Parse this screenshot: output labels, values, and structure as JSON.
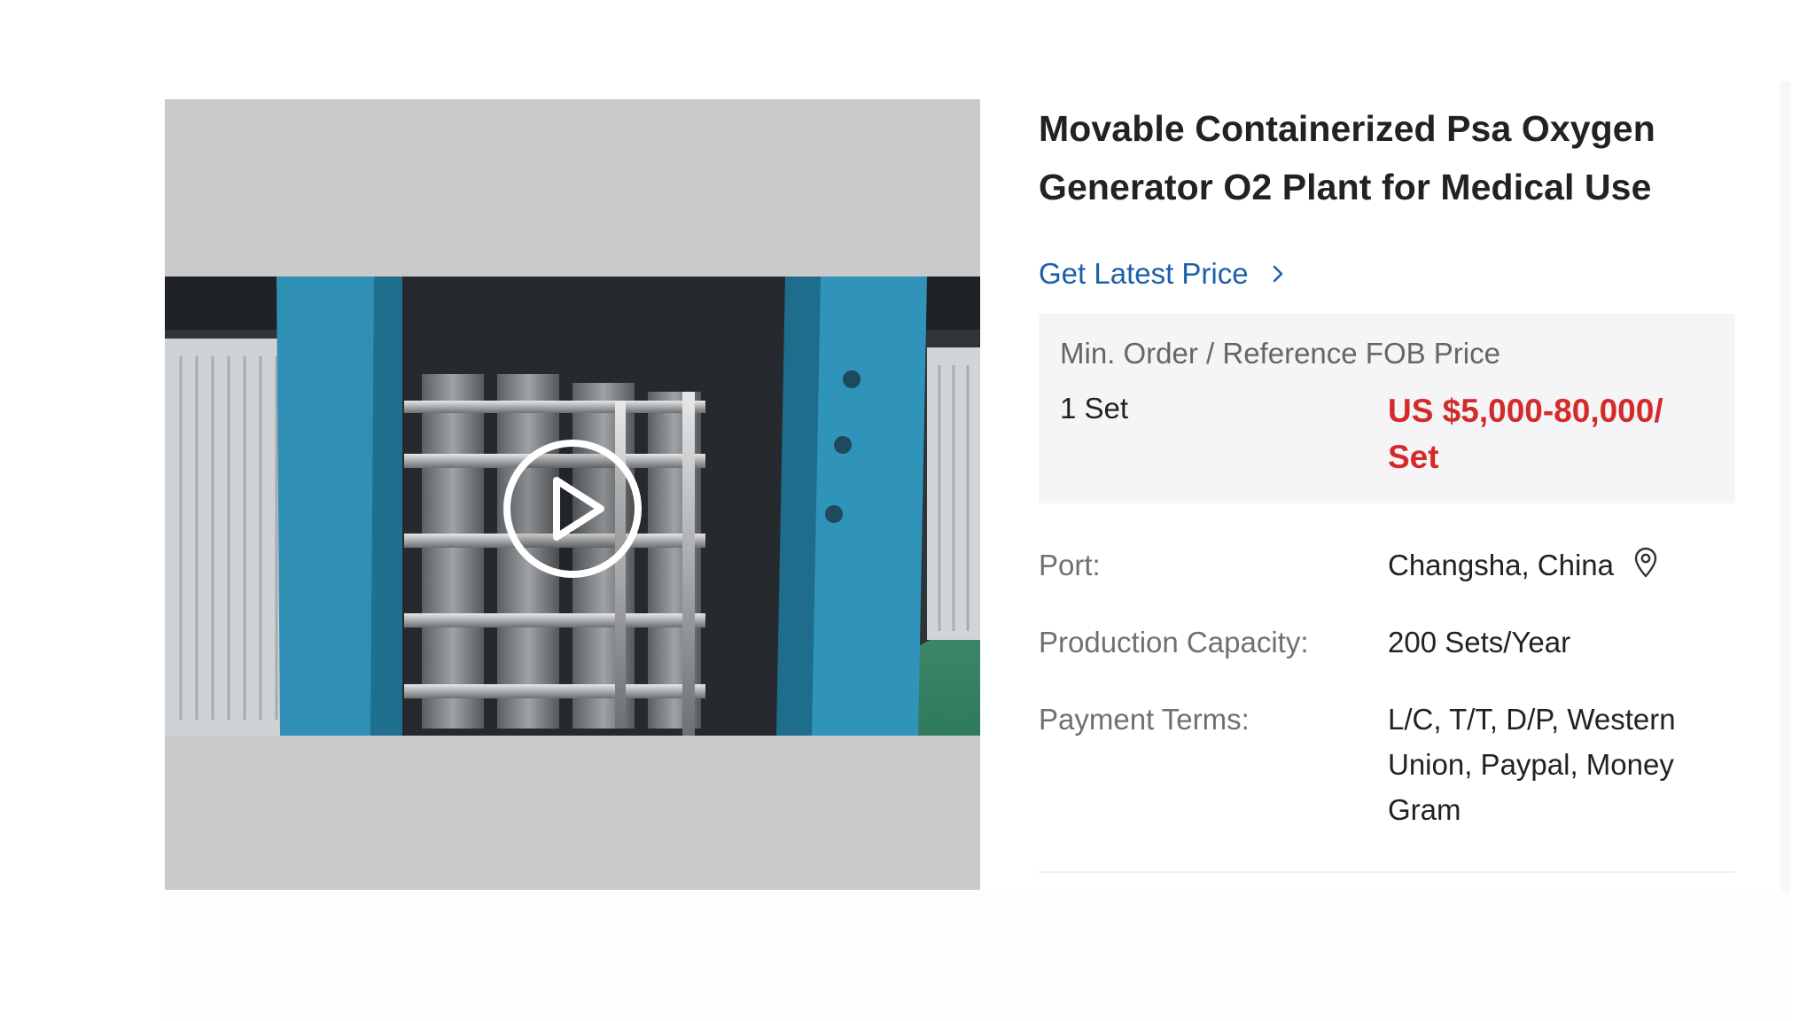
{
  "product": {
    "title": "Movable Containerized Psa Oxygen Generator O2 Plant for Medical Use",
    "price_link_label": "Get Latest Price",
    "price_box": {
      "label": "Min. Order / Reference FOB Price",
      "min_order": "1 Set",
      "price": "US $5,000-80,000/ Set"
    },
    "specs": [
      {
        "key": "Port:",
        "value": "Changsha, China",
        "icon": "location-pin-icon"
      },
      {
        "key": "Production Capacity:",
        "value": "200 Sets/Year"
      },
      {
        "key": "Payment Terms:",
        "value": "L/C, T/T, D/P, Western Union, Paypal, Money Gram"
      }
    ]
  },
  "media": {
    "play_icon": "play-circle-icon"
  },
  "colors": {
    "link": "#1d5fa8",
    "price": "#d42a2a",
    "panel": "#f5f5f7",
    "media_bg": "#cacacb"
  }
}
